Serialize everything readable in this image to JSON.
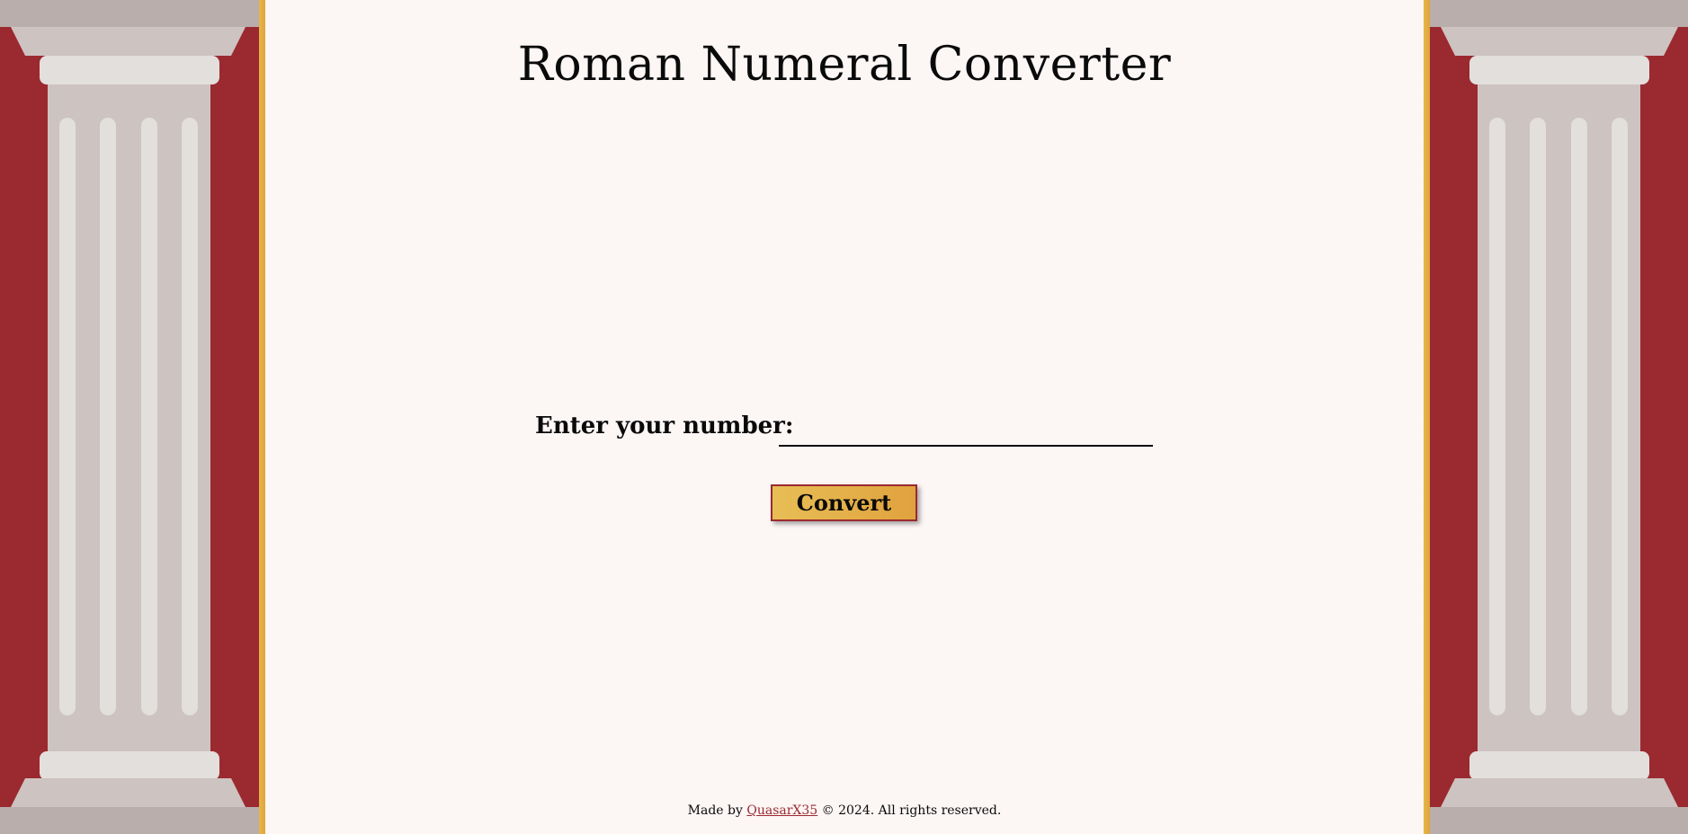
{
  "app": {
    "title": "Roman Numeral Converter"
  },
  "form": {
    "label": "Enter your number:",
    "input_value": "",
    "input_placeholder": "",
    "button_label": "Convert"
  },
  "footer": {
    "prefix": "Made by ",
    "author_link": "QuasarX35",
    "suffix": " © 2024. All rights reserved."
  },
  "colors": {
    "background_red": "#9b2930",
    "content_background": "#fcf6f5",
    "gold_accent": "#e0a43a",
    "column_stone": "#cdc3c1",
    "column_highlight": "#e2dfdc"
  },
  "decorations": {
    "left_panel": "roman-column",
    "right_panel": "roman-column"
  }
}
